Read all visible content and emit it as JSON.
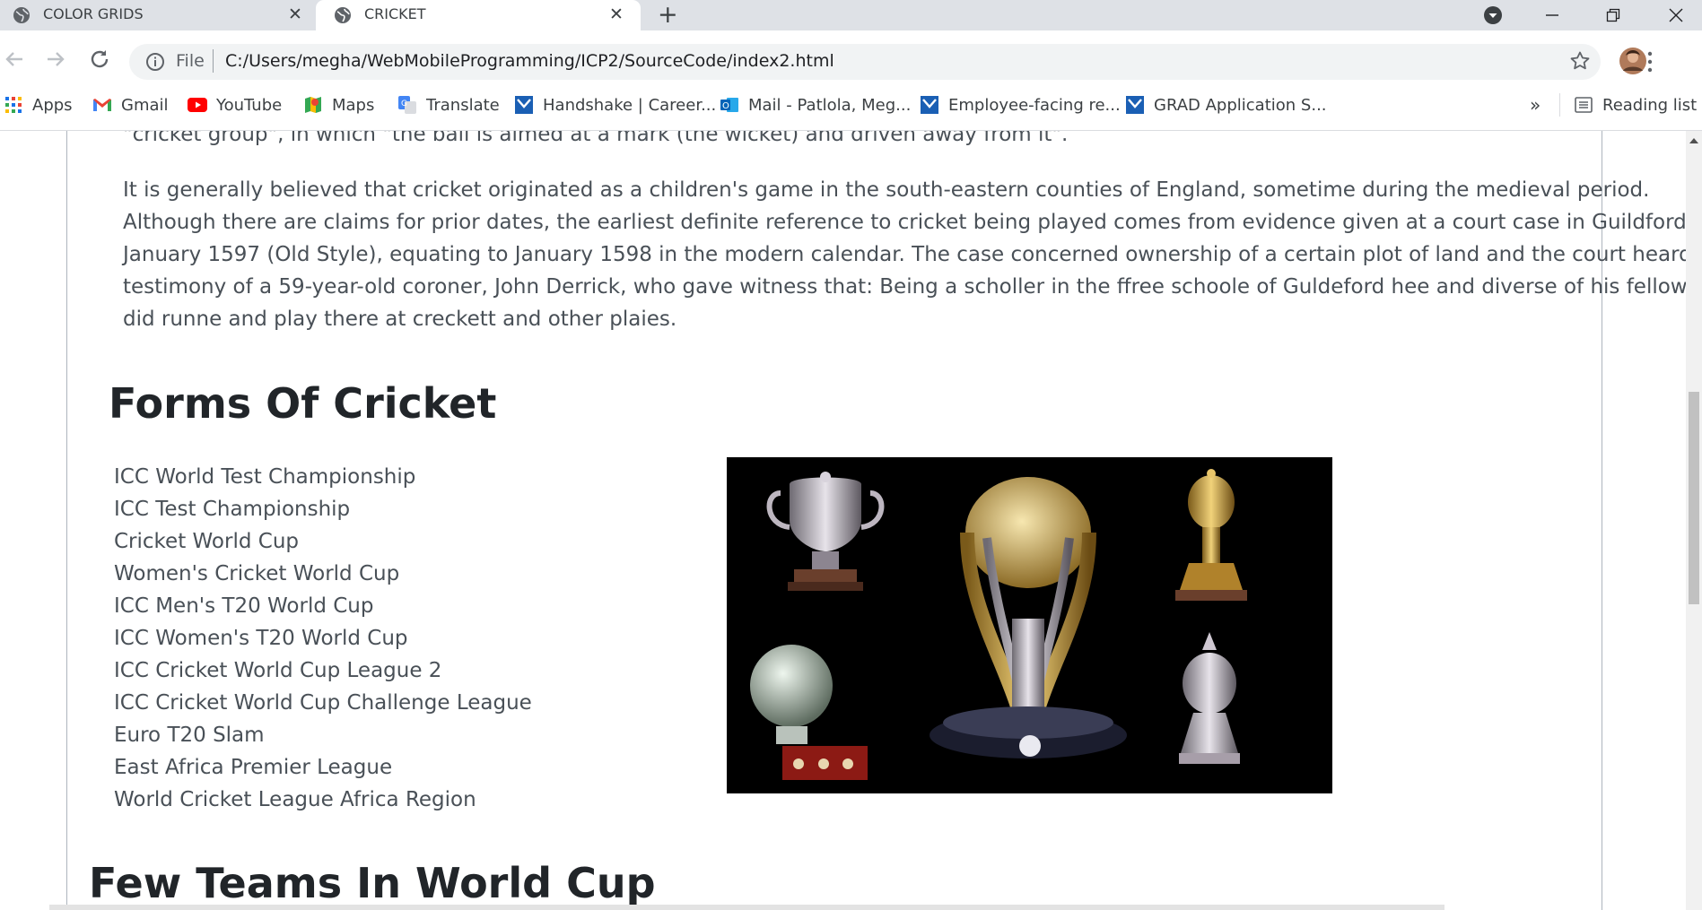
{
  "browser": {
    "tabs": [
      {
        "title": "COLOR GRIDS",
        "active": false
      },
      {
        "title": "CRICKET",
        "active": true
      }
    ],
    "address": {
      "info_label": "File",
      "url": "C:/Users/megha/WebMobileProgramming/ICP2/SourceCode/index2.html"
    },
    "bookmarks": [
      {
        "label": "Apps",
        "icon": "apps-grid-icon"
      },
      {
        "label": "Gmail",
        "icon": "gmail-icon"
      },
      {
        "label": "YouTube",
        "icon": "youtube-icon"
      },
      {
        "label": "Maps",
        "icon": "maps-icon"
      },
      {
        "label": "Translate",
        "icon": "translate-icon"
      },
      {
        "label": "Handshake | Career...",
        "icon": "handshake-icon"
      },
      {
        "label": "Mail - Patlola, Meg...",
        "icon": "outlook-icon"
      },
      {
        "label": "Employee-facing re...",
        "icon": "handshake-icon"
      },
      {
        "label": "GRAD Application S...",
        "icon": "handshake-icon"
      }
    ],
    "overflow": "»",
    "reading_list": "Reading list",
    "colors": {
      "tabbar": "#dee1e6",
      "omnibox": "#f1f3f4",
      "youtube": "#ff0000",
      "gmail": "#ea4335",
      "handshake": "#1a5fb4"
    }
  },
  "page": {
    "intro_line": "\"cricket group\", in which \"the ball is aimed at a mark (the wicket) and driven away from it\".",
    "history_lines": [
      "It is generally believed that cricket originated as a children's game in the south-eastern counties of England, sometime during the medieval period.",
      "Although there are claims for prior dates, the earliest definite reference to cricket being played comes from evidence given at a court case in Guildford in",
      "January 1597 (Old Style), equating to January 1598 in the modern calendar. The case concerned ownership of a certain plot of land and the court heard the",
      "testimony of a 59-year-old coroner, John Derrick, who gave witness that: Being a scholler in the ffree schoole of Guldeford hee and diverse of his fellows",
      "did runne and play there at creckett and other plaies."
    ],
    "forms_heading": "Forms Of Cricket",
    "forms": [
      "ICC World Test Championship",
      "ICC Test Championship",
      "Cricket World Cup",
      "Women's Cricket World Cup",
      "ICC Men's T20 World Cup",
      "ICC Women's T20 World Cup",
      "ICC Cricket World Cup League 2",
      "ICC Cricket World Cup Challenge League",
      "Euro T20 Slam",
      "East Africa Premier League",
      "World Cricket League Africa Region"
    ],
    "teams_heading": "Few Teams In World Cup",
    "image": {
      "subject": "cricket trophies collage",
      "background": "#000000"
    }
  }
}
